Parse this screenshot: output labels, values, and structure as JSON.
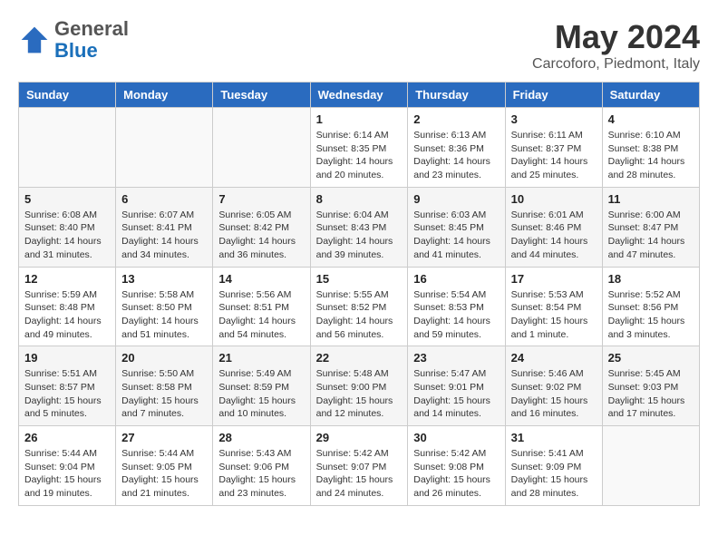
{
  "header": {
    "logo_line1": "General",
    "logo_line2": "Blue",
    "main_title": "May 2024",
    "sub_title": "Carcoforo, Piedmont, Italy"
  },
  "days_of_week": [
    "Sunday",
    "Monday",
    "Tuesday",
    "Wednesday",
    "Thursday",
    "Friday",
    "Saturday"
  ],
  "weeks": [
    [
      {
        "day": "",
        "info": ""
      },
      {
        "day": "",
        "info": ""
      },
      {
        "day": "",
        "info": ""
      },
      {
        "day": "1",
        "info": "Sunrise: 6:14 AM\nSunset: 8:35 PM\nDaylight: 14 hours\nand 20 minutes."
      },
      {
        "day": "2",
        "info": "Sunrise: 6:13 AM\nSunset: 8:36 PM\nDaylight: 14 hours\nand 23 minutes."
      },
      {
        "day": "3",
        "info": "Sunrise: 6:11 AM\nSunset: 8:37 PM\nDaylight: 14 hours\nand 25 minutes."
      },
      {
        "day": "4",
        "info": "Sunrise: 6:10 AM\nSunset: 8:38 PM\nDaylight: 14 hours\nand 28 minutes."
      }
    ],
    [
      {
        "day": "5",
        "info": "Sunrise: 6:08 AM\nSunset: 8:40 PM\nDaylight: 14 hours\nand 31 minutes."
      },
      {
        "day": "6",
        "info": "Sunrise: 6:07 AM\nSunset: 8:41 PM\nDaylight: 14 hours\nand 34 minutes."
      },
      {
        "day": "7",
        "info": "Sunrise: 6:05 AM\nSunset: 8:42 PM\nDaylight: 14 hours\nand 36 minutes."
      },
      {
        "day": "8",
        "info": "Sunrise: 6:04 AM\nSunset: 8:43 PM\nDaylight: 14 hours\nand 39 minutes."
      },
      {
        "day": "9",
        "info": "Sunrise: 6:03 AM\nSunset: 8:45 PM\nDaylight: 14 hours\nand 41 minutes."
      },
      {
        "day": "10",
        "info": "Sunrise: 6:01 AM\nSunset: 8:46 PM\nDaylight: 14 hours\nand 44 minutes."
      },
      {
        "day": "11",
        "info": "Sunrise: 6:00 AM\nSunset: 8:47 PM\nDaylight: 14 hours\nand 47 minutes."
      }
    ],
    [
      {
        "day": "12",
        "info": "Sunrise: 5:59 AM\nSunset: 8:48 PM\nDaylight: 14 hours\nand 49 minutes."
      },
      {
        "day": "13",
        "info": "Sunrise: 5:58 AM\nSunset: 8:50 PM\nDaylight: 14 hours\nand 51 minutes."
      },
      {
        "day": "14",
        "info": "Sunrise: 5:56 AM\nSunset: 8:51 PM\nDaylight: 14 hours\nand 54 minutes."
      },
      {
        "day": "15",
        "info": "Sunrise: 5:55 AM\nSunset: 8:52 PM\nDaylight: 14 hours\nand 56 minutes."
      },
      {
        "day": "16",
        "info": "Sunrise: 5:54 AM\nSunset: 8:53 PM\nDaylight: 14 hours\nand 59 minutes."
      },
      {
        "day": "17",
        "info": "Sunrise: 5:53 AM\nSunset: 8:54 PM\nDaylight: 15 hours\nand 1 minute."
      },
      {
        "day": "18",
        "info": "Sunrise: 5:52 AM\nSunset: 8:56 PM\nDaylight: 15 hours\nand 3 minutes."
      }
    ],
    [
      {
        "day": "19",
        "info": "Sunrise: 5:51 AM\nSunset: 8:57 PM\nDaylight: 15 hours\nand 5 minutes."
      },
      {
        "day": "20",
        "info": "Sunrise: 5:50 AM\nSunset: 8:58 PM\nDaylight: 15 hours\nand 7 minutes."
      },
      {
        "day": "21",
        "info": "Sunrise: 5:49 AM\nSunset: 8:59 PM\nDaylight: 15 hours\nand 10 minutes."
      },
      {
        "day": "22",
        "info": "Sunrise: 5:48 AM\nSunset: 9:00 PM\nDaylight: 15 hours\nand 12 minutes."
      },
      {
        "day": "23",
        "info": "Sunrise: 5:47 AM\nSunset: 9:01 PM\nDaylight: 15 hours\nand 14 minutes."
      },
      {
        "day": "24",
        "info": "Sunrise: 5:46 AM\nSunset: 9:02 PM\nDaylight: 15 hours\nand 16 minutes."
      },
      {
        "day": "25",
        "info": "Sunrise: 5:45 AM\nSunset: 9:03 PM\nDaylight: 15 hours\nand 17 minutes."
      }
    ],
    [
      {
        "day": "26",
        "info": "Sunrise: 5:44 AM\nSunset: 9:04 PM\nDaylight: 15 hours\nand 19 minutes."
      },
      {
        "day": "27",
        "info": "Sunrise: 5:44 AM\nSunset: 9:05 PM\nDaylight: 15 hours\nand 21 minutes."
      },
      {
        "day": "28",
        "info": "Sunrise: 5:43 AM\nSunset: 9:06 PM\nDaylight: 15 hours\nand 23 minutes."
      },
      {
        "day": "29",
        "info": "Sunrise: 5:42 AM\nSunset: 9:07 PM\nDaylight: 15 hours\nand 24 minutes."
      },
      {
        "day": "30",
        "info": "Sunrise: 5:42 AM\nSunset: 9:08 PM\nDaylight: 15 hours\nand 26 minutes."
      },
      {
        "day": "31",
        "info": "Sunrise: 5:41 AM\nSunset: 9:09 PM\nDaylight: 15 hours\nand 28 minutes."
      },
      {
        "day": "",
        "info": ""
      }
    ]
  ]
}
